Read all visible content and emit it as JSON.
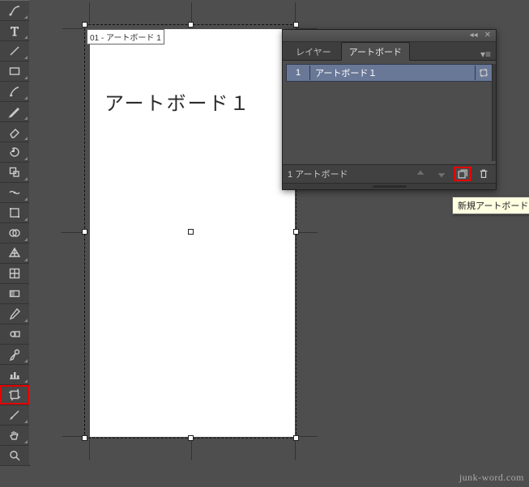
{
  "tools": {
    "items": [
      {
        "name": "curvature-tool",
        "glyph": "curvature",
        "tri": true
      },
      {
        "name": "type-tool",
        "glyph": "type",
        "tri": true
      },
      {
        "name": "line-segment-tool",
        "glyph": "line",
        "tri": true
      },
      {
        "name": "rectangle-tool",
        "glyph": "rect",
        "tri": true
      },
      {
        "name": "paintbrush-tool",
        "glyph": "brush",
        "tri": true
      },
      {
        "name": "pencil-tool",
        "glyph": "pencil",
        "tri": true
      },
      {
        "name": "eraser-tool",
        "glyph": "eraser",
        "tri": true
      },
      {
        "name": "rotate-tool",
        "glyph": "rotate",
        "tri": true
      },
      {
        "name": "scale-tool",
        "glyph": "scale",
        "tri": true
      },
      {
        "name": "width-tool",
        "glyph": "width",
        "tri": true
      },
      {
        "name": "free-transform-tool",
        "glyph": "freetrans",
        "tri": true
      },
      {
        "name": "shape-builder-tool",
        "glyph": "shapebuild",
        "tri": true
      },
      {
        "name": "perspective-grid-tool",
        "glyph": "perspective",
        "tri": true
      },
      {
        "name": "mesh-tool",
        "glyph": "mesh",
        "tri": false
      },
      {
        "name": "gradient-tool",
        "glyph": "gradient",
        "tri": false
      },
      {
        "name": "eyedropper-tool",
        "glyph": "eyedrop",
        "tri": true
      },
      {
        "name": "blend-tool",
        "glyph": "blend",
        "tri": false
      },
      {
        "name": "symbol-sprayer-tool",
        "glyph": "spray",
        "tri": true
      },
      {
        "name": "column-graph-tool",
        "glyph": "graph",
        "tri": true
      },
      {
        "name": "artboard-tool",
        "glyph": "artboard",
        "tri": false,
        "selected": true
      },
      {
        "name": "slice-tool",
        "glyph": "slice",
        "tri": true
      },
      {
        "name": "hand-tool",
        "glyph": "hand",
        "tri": true
      },
      {
        "name": "zoom-tool",
        "glyph": "zoom",
        "tri": false
      }
    ]
  },
  "artboard": {
    "overlay_label": "01 - アートボード 1",
    "title": "アートボード１"
  },
  "panel": {
    "tabs": {
      "layers": "レイヤー",
      "artboards": "アートボード"
    },
    "active_tab": "artboards",
    "rows": [
      {
        "index": "1",
        "name": "アートボード１"
      }
    ],
    "footer_count": "1 アートボード",
    "tooltip": "新規アートボード"
  },
  "watermark": "junk-word.com"
}
